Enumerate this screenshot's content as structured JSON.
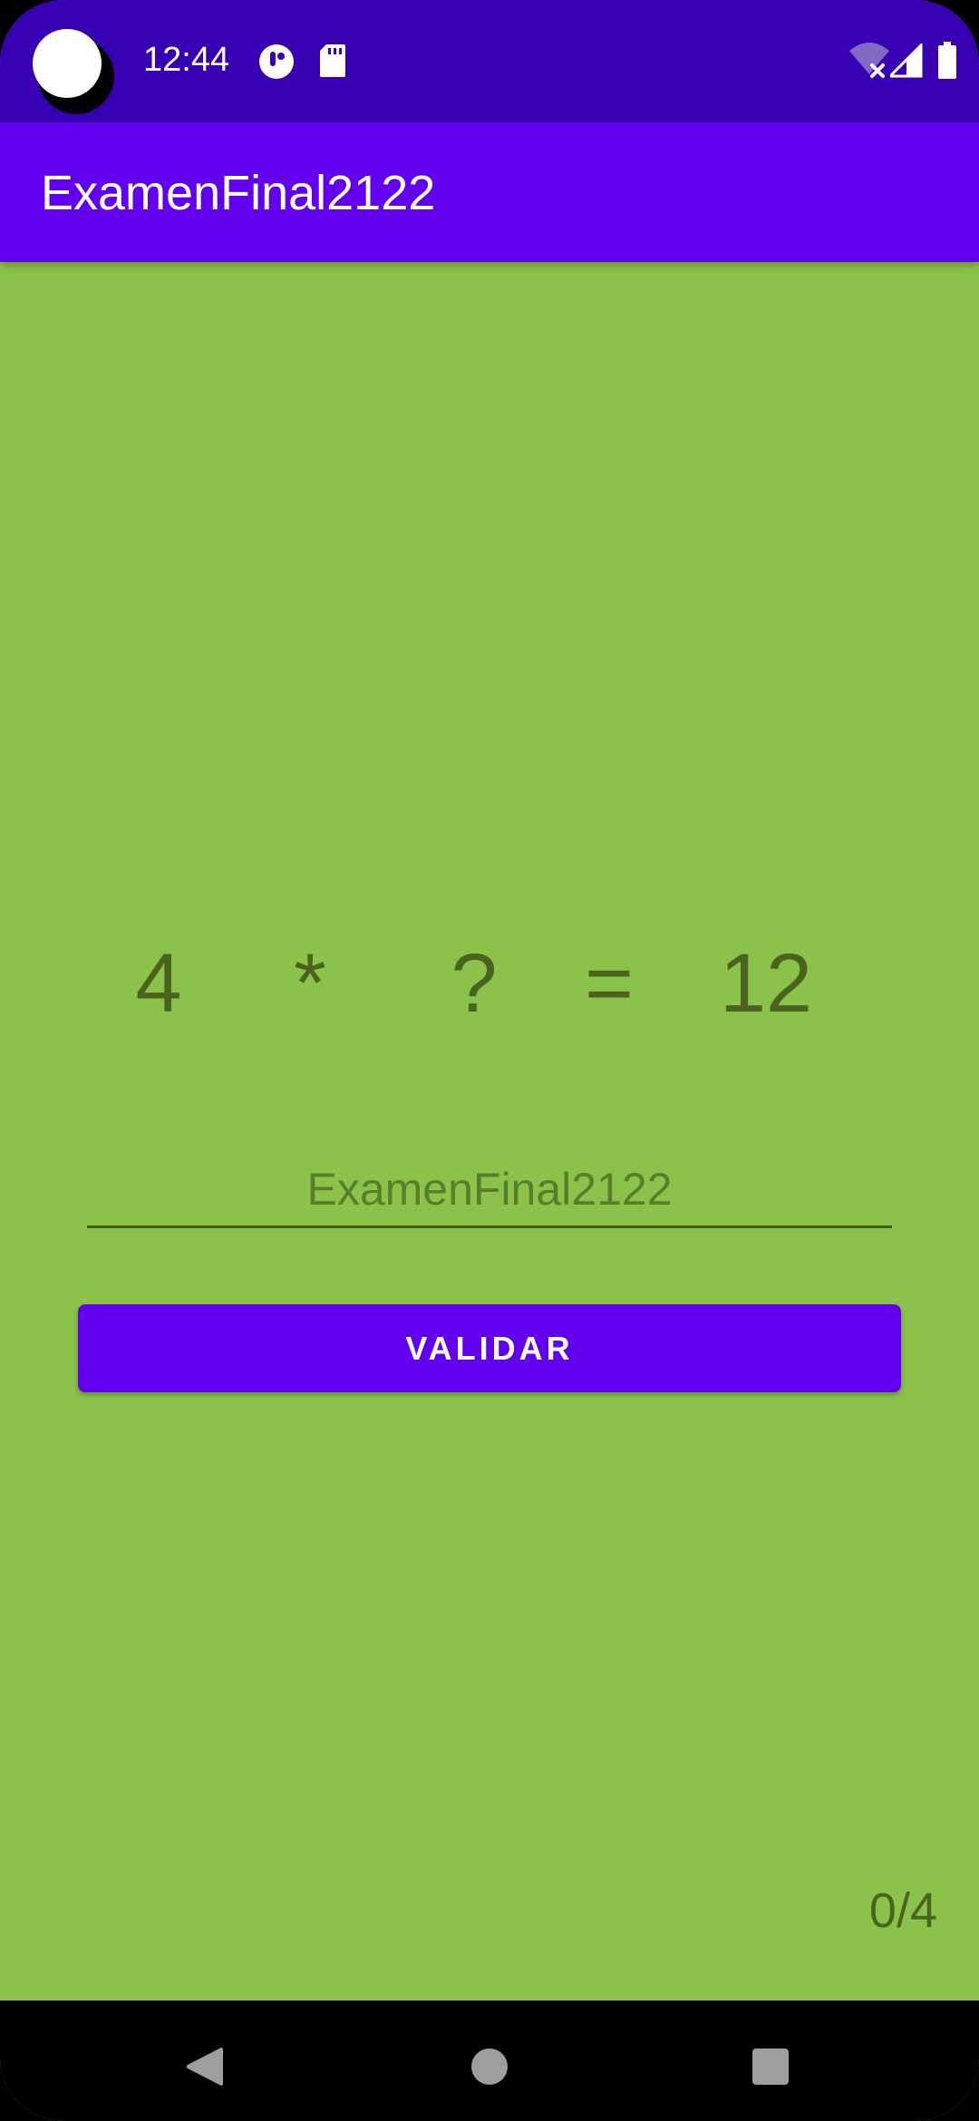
{
  "status_bar": {
    "time": "12:44",
    "icons": [
      "notification-app-icon",
      "sd-card-icon",
      "wifi-off-icon",
      "cellular-signal-icon",
      "battery-icon"
    ],
    "background": "#3700B3"
  },
  "app_bar": {
    "title": "ExamenFinal2122",
    "background": "#6200EE"
  },
  "equation": {
    "operand1": "4",
    "operator": "*",
    "unknown": "?",
    "equals": "=",
    "result": "12",
    "color": "#4B631F"
  },
  "answer_field": {
    "value": "",
    "placeholder": "ExamenFinal2122"
  },
  "validate_button": {
    "label": "VALIDAR",
    "color": "#6200EE"
  },
  "score": {
    "text": "0/4"
  },
  "screen": {
    "background": "#8BC34A"
  },
  "nav_bar": {
    "icons": [
      "back-icon",
      "home-icon",
      "recents-icon"
    ]
  }
}
